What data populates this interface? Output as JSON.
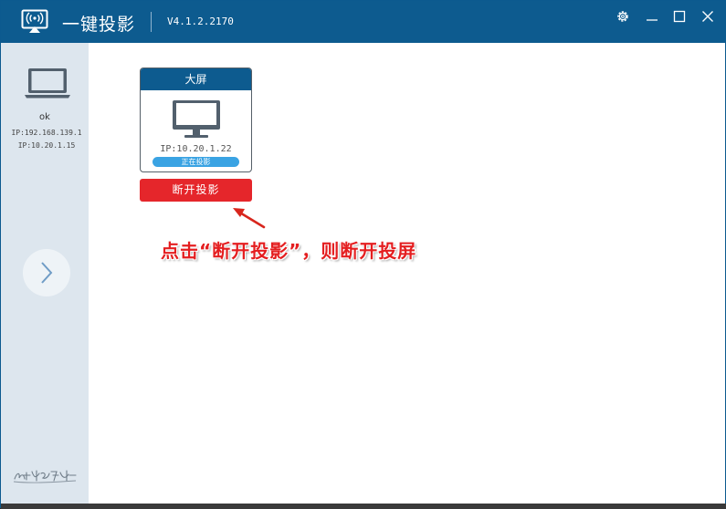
{
  "app": {
    "title": "一键投影",
    "version": "V4.1.2.2170",
    "accent_color": "#0d5b8f"
  },
  "window_controls": {
    "settings_icon": "gear-icon",
    "minimize_icon": "minimize-icon",
    "maximize_icon": "maximize-icon",
    "close_icon": "close-icon"
  },
  "sidebar": {
    "device_icon": "laptop-icon",
    "device_name": "ok",
    "ip_lines": [
      "IP:192.168.139.1",
      "IP:10.20.1.15"
    ],
    "next_icon": "chevron-right-icon",
    "slogan_icon": "handwritten-slogan"
  },
  "card": {
    "title": "大屏",
    "icon": "monitor-icon",
    "ip": "IP:10.20.1.22",
    "status": "正在投影",
    "status_color": "#3aa3e3"
  },
  "disconnect_button": {
    "label": "断开投影",
    "color": "#e5262b"
  },
  "annotation": {
    "text": "点击“断开投影”，则断开投屏",
    "color": "#e41e20"
  }
}
